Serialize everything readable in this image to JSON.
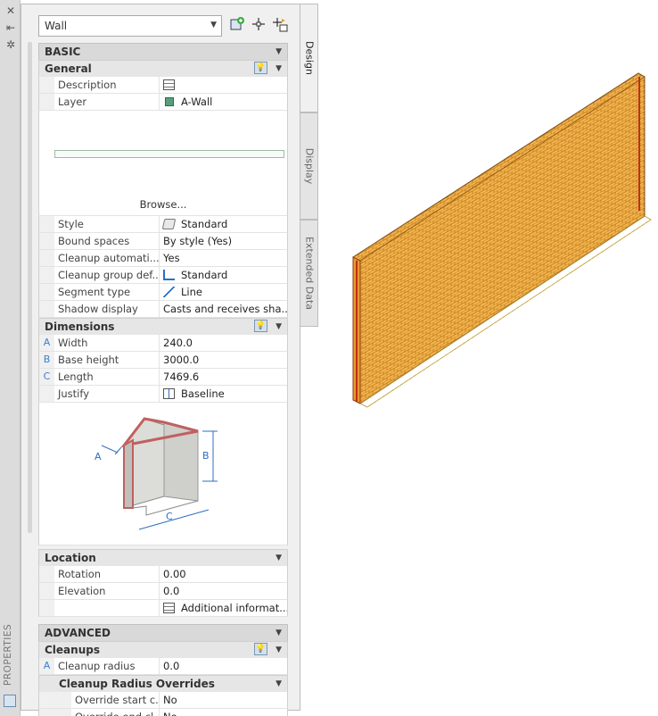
{
  "palette": {
    "title": "PROPERTIES",
    "object_selector": "Wall",
    "tabs": [
      "Design",
      "Display",
      "Extended Data"
    ],
    "basic_section": "BASIC",
    "general": {
      "title": "General",
      "rows": [
        {
          "label": "Description",
          "value": ""
        },
        {
          "label": "Layer",
          "value": "A-Wall"
        }
      ],
      "browse_label": "Browse...",
      "rows2": [
        {
          "label": "Style",
          "value": "Standard"
        },
        {
          "label": "Bound spaces",
          "value": "By style (Yes)"
        },
        {
          "label": "Cleanup automati...",
          "value": "Yes"
        },
        {
          "label": "Cleanup group def...",
          "value": "Standard"
        },
        {
          "label": "Segment type",
          "value": "Line"
        },
        {
          "label": "Shadow display",
          "value": "Casts and receives sha..."
        }
      ]
    },
    "dimensions": {
      "title": "Dimensions",
      "rows": [
        {
          "marker": "A",
          "label": "Width",
          "value": "240.0"
        },
        {
          "marker": "B",
          "label": "Base height",
          "value": "3000.0"
        },
        {
          "marker": "C",
          "label": "Length",
          "value": "7469.6"
        },
        {
          "marker": "",
          "label": "Justify",
          "value": "Baseline"
        }
      ],
      "diagram_labels": {
        "a": "A",
        "b": "B",
        "c": "C"
      }
    },
    "location": {
      "title": "Location",
      "rows": [
        {
          "label": "Rotation",
          "value": "0.00"
        },
        {
          "label": "Elevation",
          "value": "0.0"
        },
        {
          "label": "",
          "value": "Additional informat..."
        }
      ]
    },
    "advanced_section": "ADVANCED",
    "cleanups": {
      "title": "Cleanups",
      "rows": [
        {
          "marker": "A",
          "label": "Cleanup radius",
          "value": "0.0"
        }
      ],
      "overrides_title": "Cleanup Radius Overrides",
      "overrides": [
        {
          "label": "Override start c...",
          "value": "No"
        },
        {
          "label": "Override end cl...",
          "value": "No"
        }
      ]
    }
  },
  "colors": {
    "wall_brick": "#e8a23a",
    "wall_mortar": "#b86a10",
    "marker_blue": "#3a7fd0"
  },
  "icons": {
    "close": "close-icon",
    "autohide": "autohide-icon",
    "settings": "settings-icon"
  }
}
